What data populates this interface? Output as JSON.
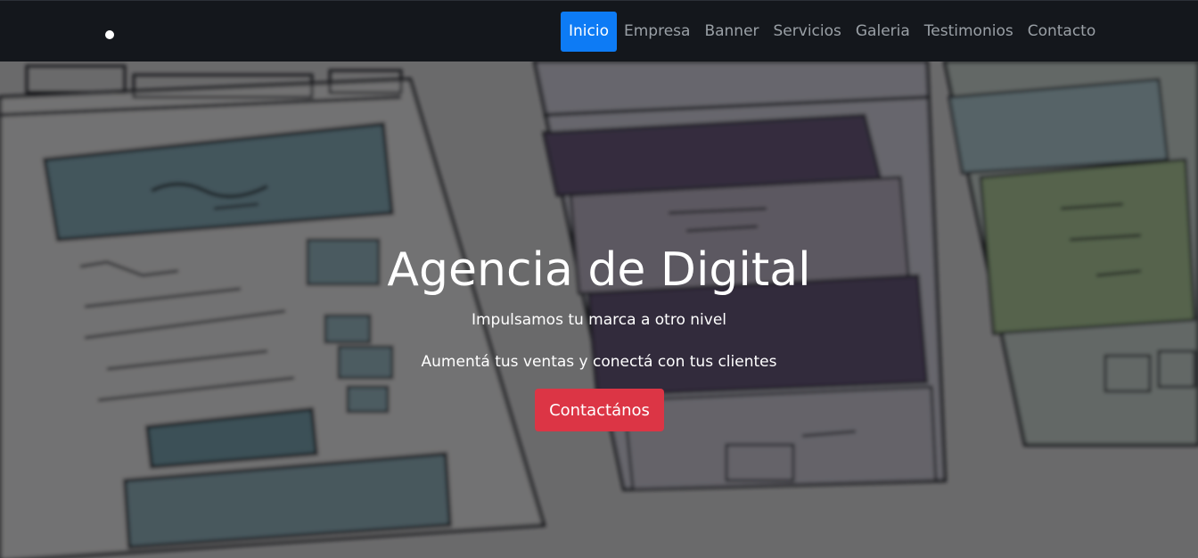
{
  "navbar": {
    "brand_icon": "dot-logo-icon",
    "links": [
      {
        "label": "Inicio",
        "active": true
      },
      {
        "label": "Empresa",
        "active": false
      },
      {
        "label": "Banner",
        "active": false
      },
      {
        "label": "Servicios",
        "active": false
      },
      {
        "label": "Galeria",
        "active": false
      },
      {
        "label": "Testimonios",
        "active": false
      },
      {
        "label": "Contacto",
        "active": false
      }
    ]
  },
  "hero": {
    "title": "Agencia de Digital",
    "subtitle": "Impulsamos tu marca a otro nivel",
    "text": "Aumentá tus ventas y conectá con tus clientes",
    "cta_label": "Contactános"
  },
  "colors": {
    "navbar_bg": "#14171c",
    "active_link": "#0d7bf5",
    "cta": "#dc3545"
  }
}
